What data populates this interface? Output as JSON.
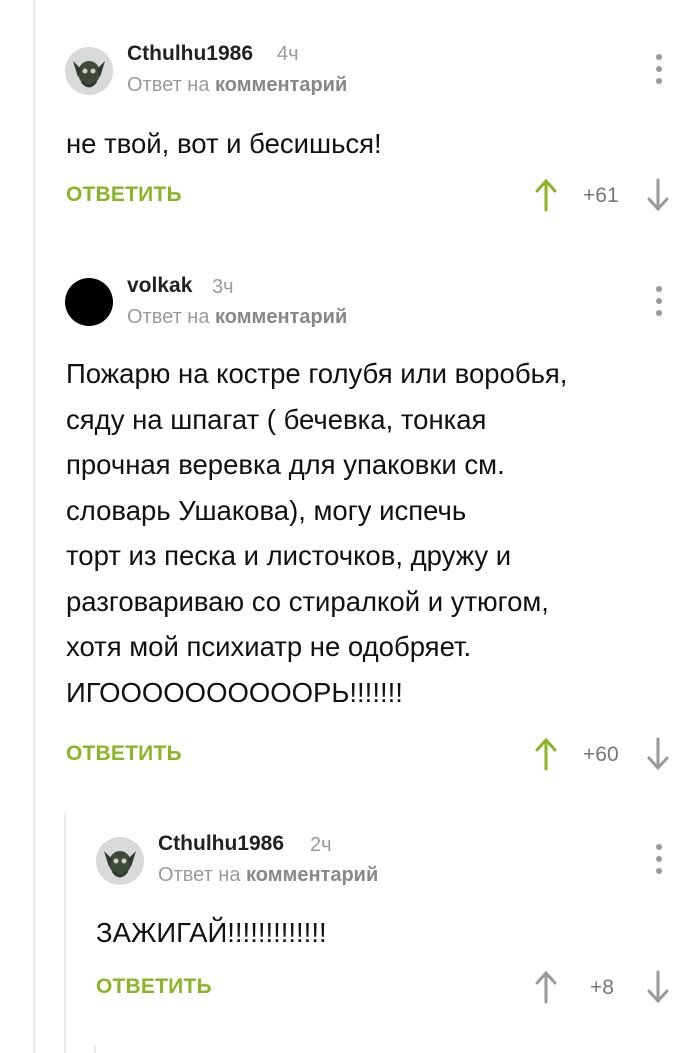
{
  "comments": [
    {
      "author": "Cthulhu1986",
      "time": "4ч",
      "reply_prefix": "Ответ на",
      "reply_link": "комментарий",
      "text_lines": [
        "не твой, вот и бесишься!"
      ],
      "reply_label": "ОТВЕТИТЬ",
      "score": "+61",
      "avatar": "cthulhu-skull",
      "upvote_active": true
    },
    {
      "author": "volkak",
      "time": "3ч",
      "reply_prefix": "Ответ на",
      "reply_link": "комментарий",
      "text_lines": [
        "Пожарю на костре голубя или воробья,",
        "сяду на шпагат ( бечевка, тонкая",
        "прочная веревка для упаковки см.",
        "словарь Ушакова), могу испечь",
        "торт из песка и листочков, дружу и",
        "разговариваю со стиралкой и утюгом,",
        "хотя мой психиатр не одобряет.",
        "ИГООООООООООРЬ!!!!!!!"
      ],
      "reply_label": "ОТВЕТИТЬ",
      "score": "+60",
      "avatar": "black-circle",
      "upvote_active": true
    },
    {
      "author": "Cthulhu1986",
      "time": "2ч",
      "reply_prefix": "Ответ на",
      "reply_link": "комментарий",
      "text_lines": [
        "ЗАЖИГАЙ!!!!!!!!!!!!!"
      ],
      "reply_label": "ОТВЕТИТЬ",
      "score": "+8",
      "avatar": "cthulhu-skull",
      "upvote_active": false
    }
  ],
  "colors": {
    "accent_green": "#8ab526",
    "muted_gray": "#9a9a9a",
    "rail": "#ececec"
  },
  "icons": [
    "more-vertical-icon",
    "arrow-up-icon",
    "arrow-down-icon"
  ]
}
